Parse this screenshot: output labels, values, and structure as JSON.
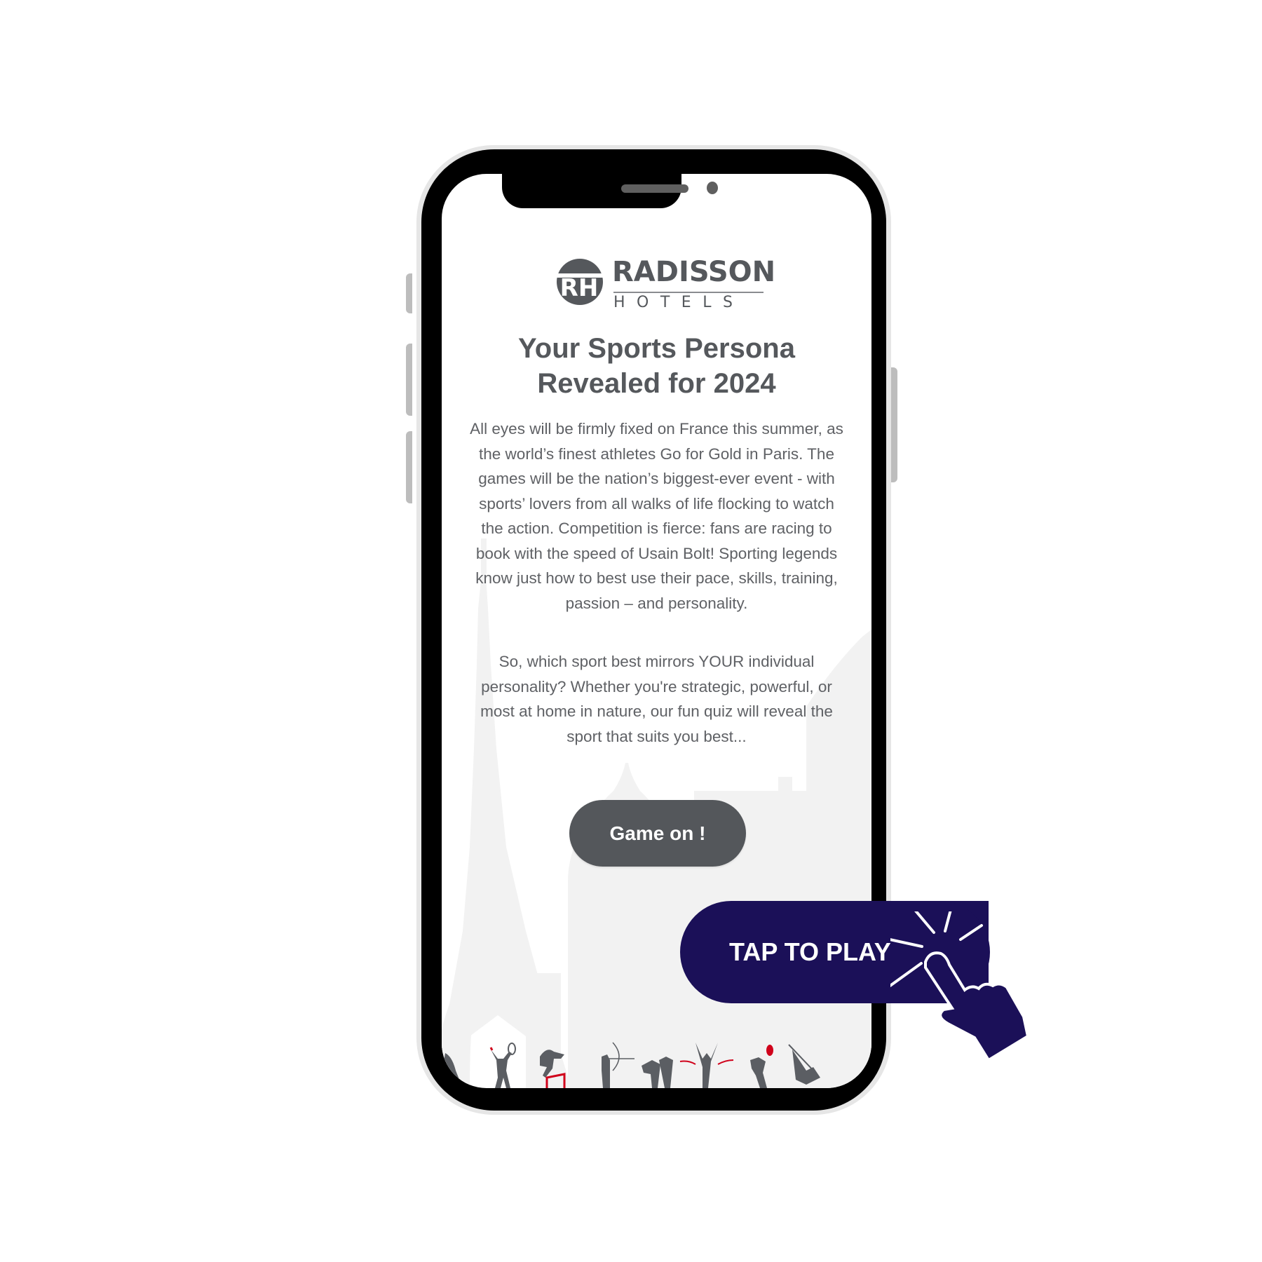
{
  "brand": {
    "logo_monogram": "RH",
    "logo_word": "RADISSON",
    "logo_sub": "HOTELS"
  },
  "hero": {
    "title_line1": "Your Sports Persona",
    "title_line2": "Revealed for 2024",
    "paragraph1": "All eyes will be firmly fixed on France this summer, as the world’s finest athletes Go for Gold in Paris. The games will be the nation’s biggest-ever event - with sports’ lovers from all walks of life flocking to watch the action. Competition is fierce: fans are racing to book with the speed of Usain Bolt! Sporting legends know just how to best use their pace, skills, training, passion – and personality.",
    "paragraph2": "So, which sport best mirrors YOUR individual personality? Whether you're strategic, powerful, or most at home in nature, our fun quiz will reveal the sport that suits you best..."
  },
  "cta": {
    "game_button_label": "Game on !",
    "tap_label": "TAP TO PLAY"
  },
  "decor": {
    "background": "paris-skyline-silhouette",
    "sports": [
      "runner",
      "tennis-player",
      "hurdler",
      "archer",
      "martial-arts",
      "sprinter-finish",
      "discus-thrower",
      "kayaker"
    ]
  },
  "colors": {
    "text_gray": "#55585c",
    "button_gray": "#54575b",
    "tap_navy": "#1b1058",
    "accent_red": "#d0021b",
    "skyline_gray": "#f2f2f2"
  }
}
